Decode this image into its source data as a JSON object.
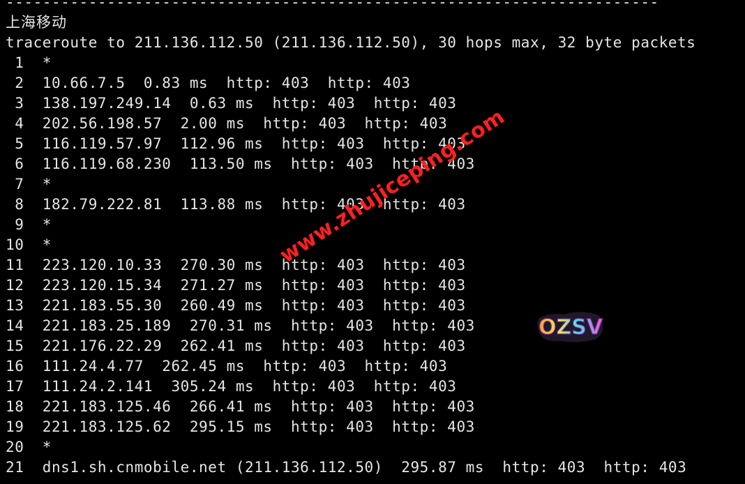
{
  "terminal": {
    "lines": [
      "-----------------------------------------------------------------------",
      "上海移动",
      "traceroute to 211.136.112.50 (211.136.112.50), 30 hops max, 32 byte packets",
      " 1  *",
      " 2  10.66.7.5  0.83 ms  http: 403  http: 403",
      " 3  138.197.249.14  0.63 ms  http: 403  http: 403",
      " 4  202.56.198.57  2.00 ms  http: 403  http: 403",
      " 5  116.119.57.97  112.96 ms  http: 403  http: 403",
      " 6  116.119.68.230  113.50 ms  http: 403  http: 403",
      " 7  *",
      " 8  182.79.222.81  113.88 ms  http: 403  http: 403",
      " 9  *",
      "10  *",
      "11  223.120.10.33  270.30 ms  http: 403  http: 403",
      "12  223.120.15.34  271.27 ms  http: 403  http: 403",
      "13  221.183.55.30  260.49 ms  http: 403  http: 403",
      "14  221.183.25.189  270.31 ms  http: 403  http: 403",
      "15  221.176.22.29  262.41 ms  http: 403  http: 403",
      "16  111.24.4.77  262.45 ms  http: 403  http: 403",
      "17  111.24.2.141  305.24 ms  http: 403  http: 403",
      "18  221.183.125.46  266.41 ms  http: 403  http: 403",
      "19  221.183.125.62  295.15 ms  http: 403  http: 403",
      "20  *",
      "21  dns1.sh.cnmobile.net (211.136.112.50)  295.87 ms  http: 403  http: 403"
    ]
  },
  "watermark": {
    "text": "www.zhujiceping.com",
    "color": "#ff2020"
  },
  "logo": {
    "text": "OZSV",
    "icon": "ozsv-logo"
  },
  "colors": {
    "background": "#000000",
    "foreground": "#e6e6e6"
  }
}
